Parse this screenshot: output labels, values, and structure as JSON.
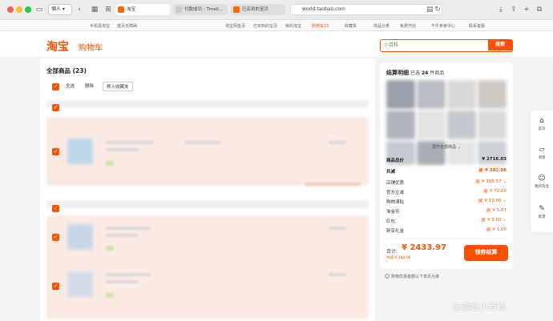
{
  "browser": {
    "profile_label": "個人",
    "tabs": [
      "淘宝",
      "付款成功 - Tmall...",
      "已买到的宝贝"
    ],
    "url": "world.taobao.com"
  },
  "topnav": {
    "left": [
      "手机逛淘宝",
      "首页无障碍"
    ],
    "right": [
      "淘宝网首页",
      "已买到的宝贝",
      "我的淘宝",
      "购物车23",
      "收藏夹",
      "商品分类",
      "免费开店",
      "千牛卖家中心",
      "联系客服"
    ]
  },
  "header": {
    "logo": "淘宝",
    "title": "购物车",
    "search_placeholder": "小百科",
    "search_button": "搜索"
  },
  "cart": {
    "all_label": "全部商品 (23)",
    "select_all": "全选",
    "delete": "删除",
    "move_fav": "移入收藏夹"
  },
  "summary": {
    "title": "结算明细",
    "selected_prefix": "已选",
    "selected_count": "24",
    "selected_suffix": "件商品",
    "expand": "展开全部商品",
    "total_label": "商品总价",
    "total_value": "¥ 2716.03",
    "discount_label": "共减",
    "discount_value": "¥ 282.06",
    "lines": [
      {
        "label": "店铺优惠",
        "value": "¥ 195.57"
      },
      {
        "label": "官方立减",
        "value": "¥ 72.00"
      },
      {
        "label": "购物津贴",
        "value": "¥ 10.00"
      },
      {
        "label": "淘金币",
        "value": "¥ 5.67"
      },
      {
        "label": "红包",
        "value": "¥ 3.00"
      },
      {
        "label": "新享礼金",
        "value": "¥ 1.00"
      }
    ],
    "tag_label": "减",
    "payable_label": "合计:",
    "payable_value": "¥ 2433.97",
    "saved": "共减 ¥ 282.06",
    "checkout": "领券结算",
    "note": "购物优惠金额以下单页为准"
  },
  "rail": [
    {
      "icon": "home-icon",
      "label": "首页"
    },
    {
      "icon": "message-icon",
      "label": "消息"
    },
    {
      "icon": "smile-icon",
      "label": "我的淘宝"
    },
    {
      "icon": "edit-icon",
      "label": "反馈"
    }
  ],
  "watermark": "@霓虹小百科",
  "colors": {
    "accent": "#ff5000"
  }
}
